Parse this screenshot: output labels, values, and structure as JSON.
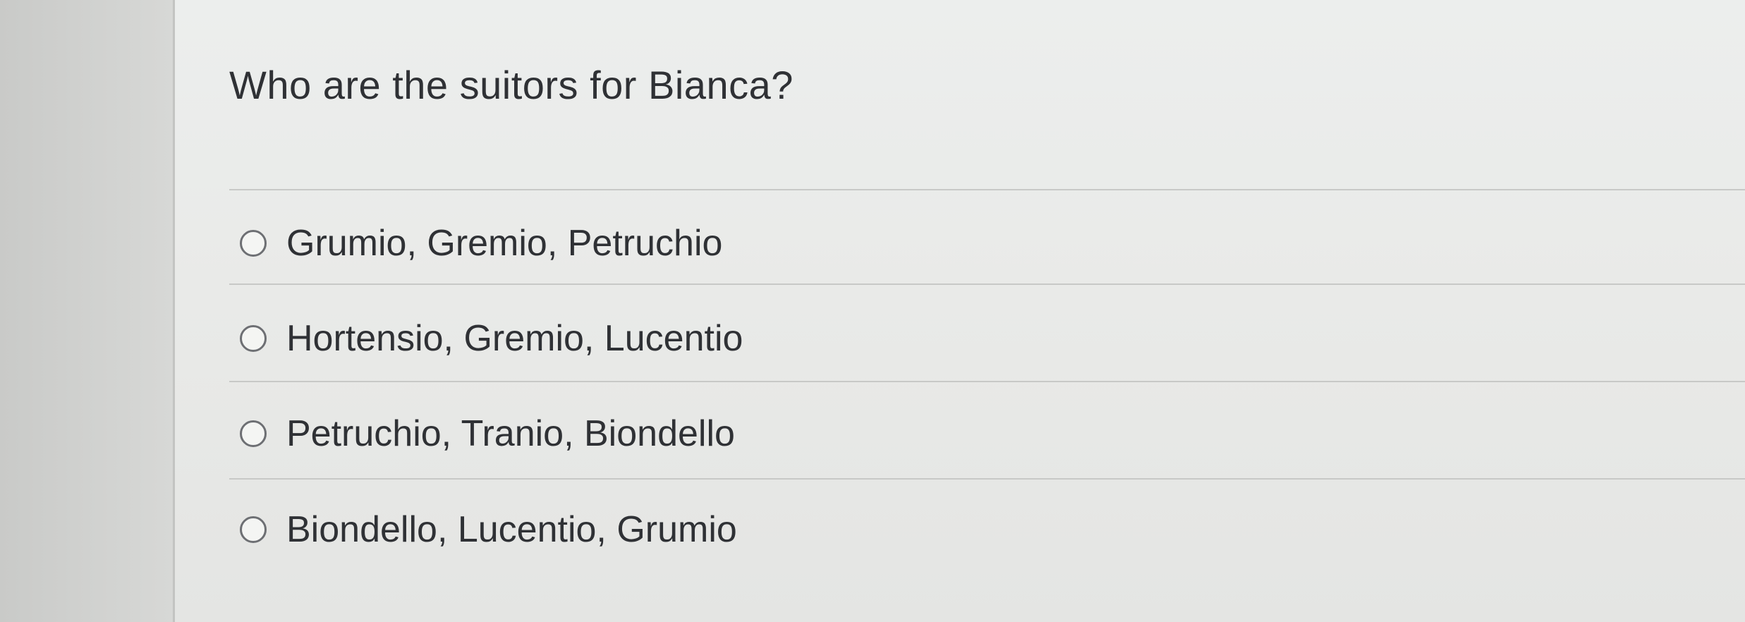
{
  "quiz": {
    "question": "Who are the suitors for Bianca?",
    "options": [
      {
        "label": "Grumio, Gremio, Petruchio"
      },
      {
        "label": "Hortensio, Gremio, Lucentio"
      },
      {
        "label": "Petruchio, Tranio, Biondello"
      },
      {
        "label": "Biondello, Lucentio, Grumio"
      }
    ]
  }
}
